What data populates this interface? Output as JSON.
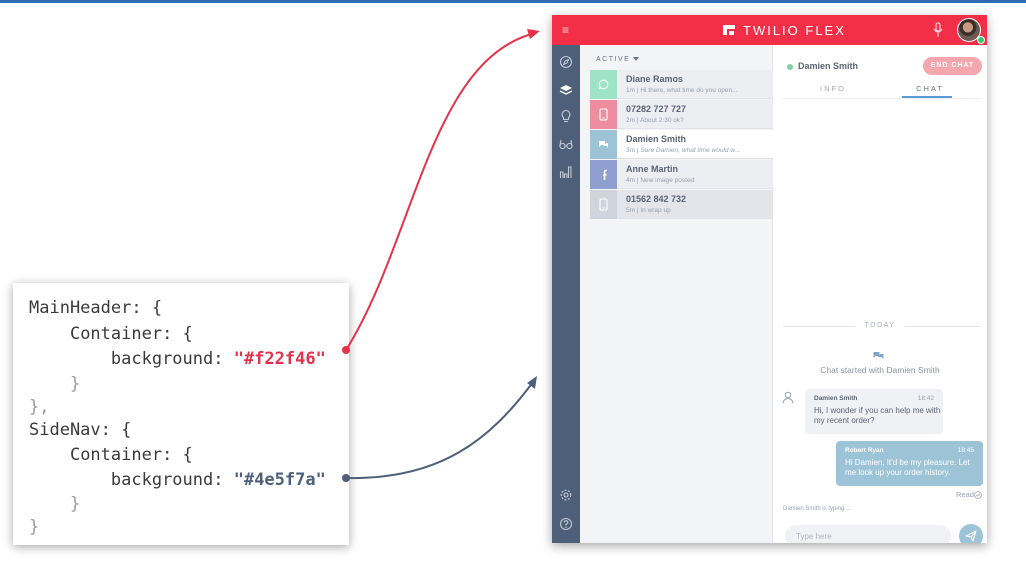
{
  "code": {
    "main_header_open": "MainHeader: {",
    "main_header_container_open": "Container: {",
    "main_header_bg_key": "background: ",
    "main_header_bg_value": "\"#f22f46\"",
    "main_header_container_close": "}",
    "main_header_close": "},",
    "side_nav_open": "SideNav: {",
    "side_nav_container_open": "Container: {",
    "side_nav_bg_key": "background: ",
    "side_nav_bg_value": "\"#4e5f7a\"",
    "side_nav_container_close": "}",
    "side_nav_close": "}"
  },
  "colors": {
    "main_header": "#f22f46",
    "side_nav": "#4e5f7a",
    "whatsapp": "#9ee3c8",
    "sms": "#ef8da0",
    "webchat": "#9cc3d6",
    "facebook": "#8f9fcf",
    "voice": "#cfd4dd"
  },
  "header": {
    "menu_icon": "hamburger-icon",
    "brand": "TWILIO FLEX",
    "mic_icon": "microphone-icon",
    "avatar": "agent-avatar"
  },
  "side_nav": {
    "items": [
      "compass-icon",
      "layers-icon",
      "lightbulb-icon",
      "glasses-icon",
      "bar-chart-icon"
    ],
    "bottom": [
      "settings-icon",
      "help-icon"
    ]
  },
  "task_list": {
    "filter_label": "ACTIVE",
    "tasks": [
      {
        "name": "Diane Ramos",
        "age": "1m",
        "preview": "Hi there, what time do you open...",
        "channel": "whatsapp"
      },
      {
        "name": "07282 727 727",
        "age": "2m",
        "preview": "About 2:30 ok?",
        "channel": "sms"
      },
      {
        "name": "Damien Smith",
        "age": "3m",
        "preview": "Sure Damien, what time would w...",
        "channel": "webchat"
      },
      {
        "name": "Anne Martin",
        "age": "4m",
        "preview": "New image posted",
        "channel": "facebook"
      },
      {
        "name": "01562 842 732",
        "age": "5m",
        "preview": "In wrap up",
        "channel": "voice"
      }
    ]
  },
  "chat": {
    "contact": "Damien Smith",
    "end_chat": "END CHAT",
    "tabs": [
      "INFO",
      "CHAT"
    ],
    "active_tab": "CHAT",
    "divider": "TODAY",
    "started": "Chat started with Damien Smith",
    "messages": [
      {
        "author": "Damien Smith",
        "time": "18:42",
        "text": "Hi, I wonder if you can help me with my recent order?"
      },
      {
        "author": "Robert Ryan",
        "time": "18:45",
        "text": "Hi Damien, It'd be my pleasure. Let me look up your order history."
      }
    ],
    "read_status": "Read",
    "typing": "Damien Smith is typing ...",
    "input_placeholder": "Type here"
  }
}
